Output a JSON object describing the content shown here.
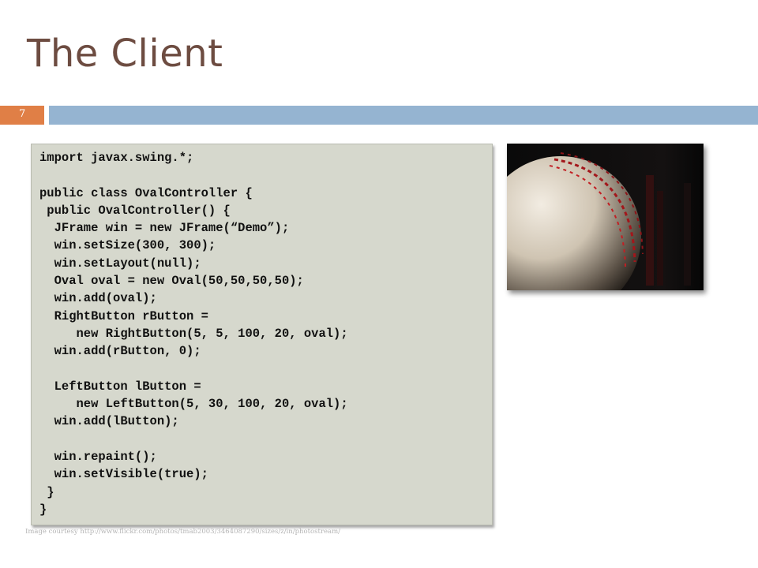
{
  "slide": {
    "title": "The Client",
    "number": "7"
  },
  "colors": {
    "title": "#6d4c41",
    "number_box": "#e07f46",
    "header_bar": "#95b4d1",
    "code_background": "#d6d8cd"
  },
  "code": {
    "text": "import javax.swing.*;\n\npublic class OvalController {\n public OvalController() {\n  JFrame win = new JFrame(“Demo”);\n  win.setSize(300, 300);\n  win.setLayout(null);\n  Oval oval = new Oval(50,50,50,50);\n  win.add(oval);\n  RightButton rButton =\n     new RightButton(5, 5, 100, 20, oval);\n  win.add(rButton, 0);\n\n  LeftButton lButton =\n     new LeftButton(5, 30, 100, 20, oval);\n  win.add(lButton);\n\n  win.repaint();\n  win.setVisible(true);\n }\n}"
  },
  "image": {
    "subject": "baseball-photo"
  },
  "credit": "Image courtesy http://www.flickr.com/photos/tmab2003/3464087290/sizes/z/in/photostream/"
}
